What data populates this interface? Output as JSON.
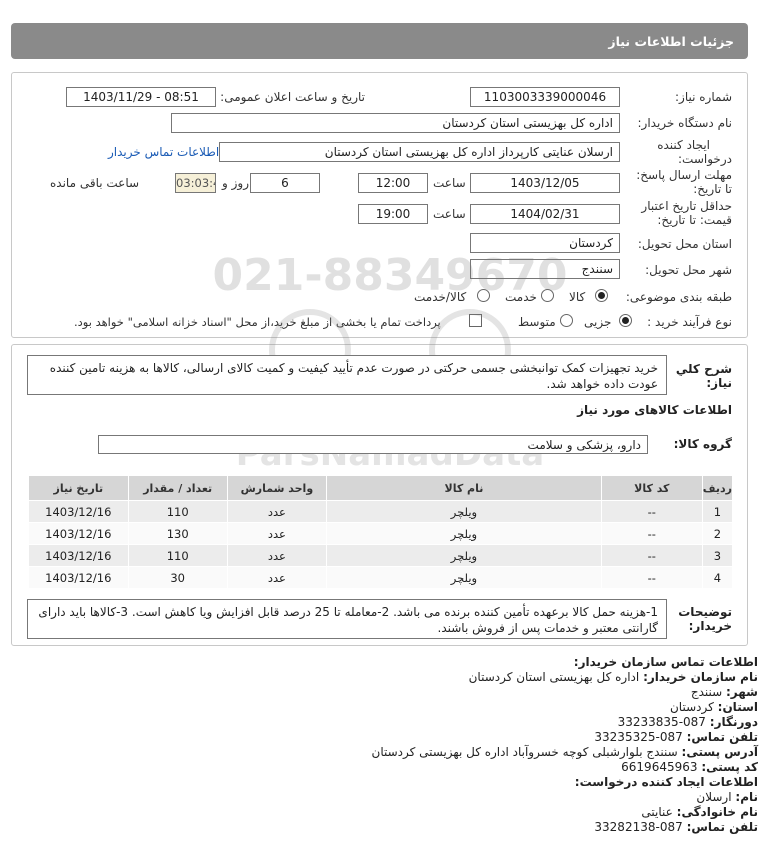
{
  "header": {
    "title": "جزئیات اطلاعات نیاز"
  },
  "form": {
    "need_number_label": "شماره نیاز:",
    "need_number": "1103003339000046",
    "announce_label": "تاریخ و ساعت اعلان عمومی:",
    "announce_value": "1403/11/29 - 08:51",
    "buyer_org_label": "نام دستگاه خریدار:",
    "buyer_org": "اداره کل بهزیستی استان کردستان",
    "creator_label_1": "ایجاد کننده",
    "creator_label_2": "درخواست:",
    "creator": "ارسلان  عنایتی کارپرداز اداره کل بهزیستی استان کردستان",
    "contact_link": "اطلاعات تماس خریدار",
    "reply_label_1": "مهلت ارسال پاسخ:",
    "reply_label_2": "تا تاریخ:",
    "reply_date": "1403/12/05",
    "time_label": "ساعت",
    "reply_time": "12:00",
    "days_value": "6",
    "days_label": "روز و",
    "remaining_time": "03:03:47",
    "remaining_label": "ساعت باقی مانده",
    "validity_label_1": "حداقل تاریخ اعتبار",
    "validity_label_2": "قیمت: تا تاریخ:",
    "validity_date": "1404/02/31",
    "validity_time": "19:00",
    "province_label": "استان محل تحویل:",
    "province": "کردستان",
    "city_label": "شهر محل تحویل:",
    "city": "سنندج",
    "category_label": "طبقه بندی موضوعی:",
    "category_options": [
      "کالا",
      "خدمت",
      "کالا/خدمت"
    ],
    "category_selected": "کالا",
    "process_label": "نوع فرآیند خرید :",
    "process_options": [
      "جزیی",
      "متوسط"
    ],
    "process_selected": "جزیی",
    "payment_note": "پرداخت تمام یا بخشی از مبلغ خرید،از محل \"اسناد خزانه اسلامی\" خواهد بود."
  },
  "details": {
    "summary_label_1": "شرح کلي",
    "summary_label_2": "نياز:",
    "summary_text": "خرید تجهیزات کمک توانبخشی جسمی حرکتی در صورت عدم تأیید کیفیت و کمیت کالای ارسالی، کالاها به هزینه تامین کننده عودت داده خواهد شد.",
    "goods_section_title": "اطلاعات کالاهای مورد نیاز",
    "group_label": "گروه کالا:",
    "group_value": "دارو، پزشکی و سلامت",
    "table": {
      "headers": [
        "ردیف",
        "کد کالا",
        "نام کالا",
        "واحد شمارش",
        "تعداد / مقدار",
        "تاریخ نیاز"
      ],
      "rows": [
        [
          "1",
          "--",
          "ویلچر",
          "عدد",
          "110",
          "1403/12/16"
        ],
        [
          "2",
          "--",
          "ویلچر",
          "عدد",
          "130",
          "1403/12/16"
        ],
        [
          "3",
          "--",
          "ویلچر",
          "عدد",
          "110",
          "1403/12/16"
        ],
        [
          "4",
          "--",
          "ویلچر",
          "عدد",
          "30",
          "1403/12/16"
        ]
      ]
    },
    "buyer_notes_label_1": "توضیحات",
    "buyer_notes_label_2": "خریدار:",
    "buyer_notes": "1-هزینه حمل کالا برعهده تأمین کننده برنده می باشد. 2-معامله تا 25 درصد قابل افزایش ویا کاهش است. 3-کالاها باید دارای گارانتی معتبر و خدمات پس از فروش باشند."
  },
  "contact": {
    "org_title": "اطلاعات تماس سازمان خریدار:",
    "org_name_label": "نام سازمان خریدار:",
    "org_name": "اداره کل بهزیستی استان کردستان",
    "city_label": "شهر:",
    "city": "سنندج",
    "province_label": "استان:",
    "province": "کردستان",
    "fax_label": "دورنگار:",
    "fax": "087-33233835",
    "phone_label": "تلفن تماس:",
    "phone": "087-33235325",
    "address_label": "آدرس پستی:",
    "address": "سنندج بلوارشبلی کوچه خسروآباد اداره کل بهزیستی کردستان",
    "postal_label": "کد پستی:",
    "postal": "6619645963",
    "creator_title": "اطلاعات ایجاد کننده درخواست:",
    "first_name_label": "نام:",
    "first_name": "ارسلان",
    "last_name_label": "نام خانوادگی:",
    "last_name": "عنایتی",
    "creator_phone_label": "تلفن تماس:",
    "creator_phone": "087-33282138"
  },
  "watermark": {
    "phone_top": "021-88349670",
    "brand": "ParsNamadData",
    "line1": "مرکز فراوری اطلاعات پارس نماد داده ها",
    "line2": "پایگاه اطلاع رسانی مناقصه مزایده",
    "phone_bottom": "۰۲۱-۸۸۳۴۹۶۷۰-۵"
  },
  "colors": {
    "header_bg": "#8a8a8a",
    "link": "#1a5bb5",
    "table_header": "#d6d6d6",
    "remaining_bg": "#f6f0d8"
  }
}
